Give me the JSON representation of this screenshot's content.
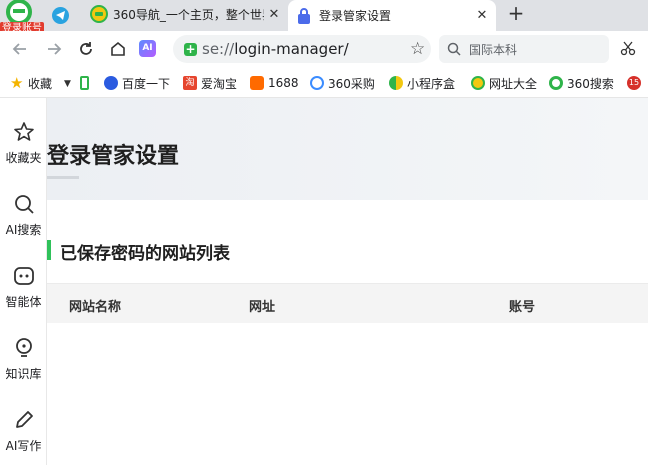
{
  "browser": {
    "login_badge": "登录账号",
    "tabs": [
      {
        "title": "360导航_一个主页，整个世界",
        "active": false
      },
      {
        "title": "登录管家设置",
        "active": true
      }
    ],
    "new_tab": "+",
    "close_glyph": "✕"
  },
  "toolbar": {
    "ai_label": "AI",
    "url_scheme": "se://",
    "url_path": "login-manager/",
    "search_placeholder": "国际本科"
  },
  "bookmarks": [
    {
      "label": "收藏",
      "icon": "star-icon"
    },
    {
      "label": "",
      "icon": "phone-icon"
    },
    {
      "label": "百度一下",
      "icon": "baidu-icon"
    },
    {
      "label": "爱淘宝",
      "icon": "taobao-icon"
    },
    {
      "label": "1688",
      "icon": "1688-icon"
    },
    {
      "label": "360采购",
      "icon": "360-purchase-icon"
    },
    {
      "label": "小程序盒",
      "icon": "miniapp-icon"
    },
    {
      "label": "网址大全",
      "icon": "url-directory-icon"
    },
    {
      "label": "360搜索",
      "icon": "360-search-icon"
    },
    {
      "label": "",
      "icon": "game-15-icon"
    }
  ],
  "sidebar": {
    "items": [
      {
        "label": "收藏夹",
        "icon": "star-outline-icon"
      },
      {
        "label": "AI搜索",
        "icon": "search-icon"
      },
      {
        "label": "智能体",
        "icon": "agent-icon"
      },
      {
        "label": "知识库",
        "icon": "bulb-icon"
      },
      {
        "label": "AI写作",
        "icon": "pencil-icon"
      }
    ]
  },
  "page": {
    "title": "登录管家设置",
    "section_title": "已保存密码的网站列表",
    "table": {
      "columns": [
        "网站名称",
        "网址",
        "账号"
      ],
      "rows": []
    }
  },
  "colors": {
    "accent_green": "#2fc15a",
    "badge_red": "#e23b2e",
    "tabstrip_bg": "#dfe1e5"
  }
}
